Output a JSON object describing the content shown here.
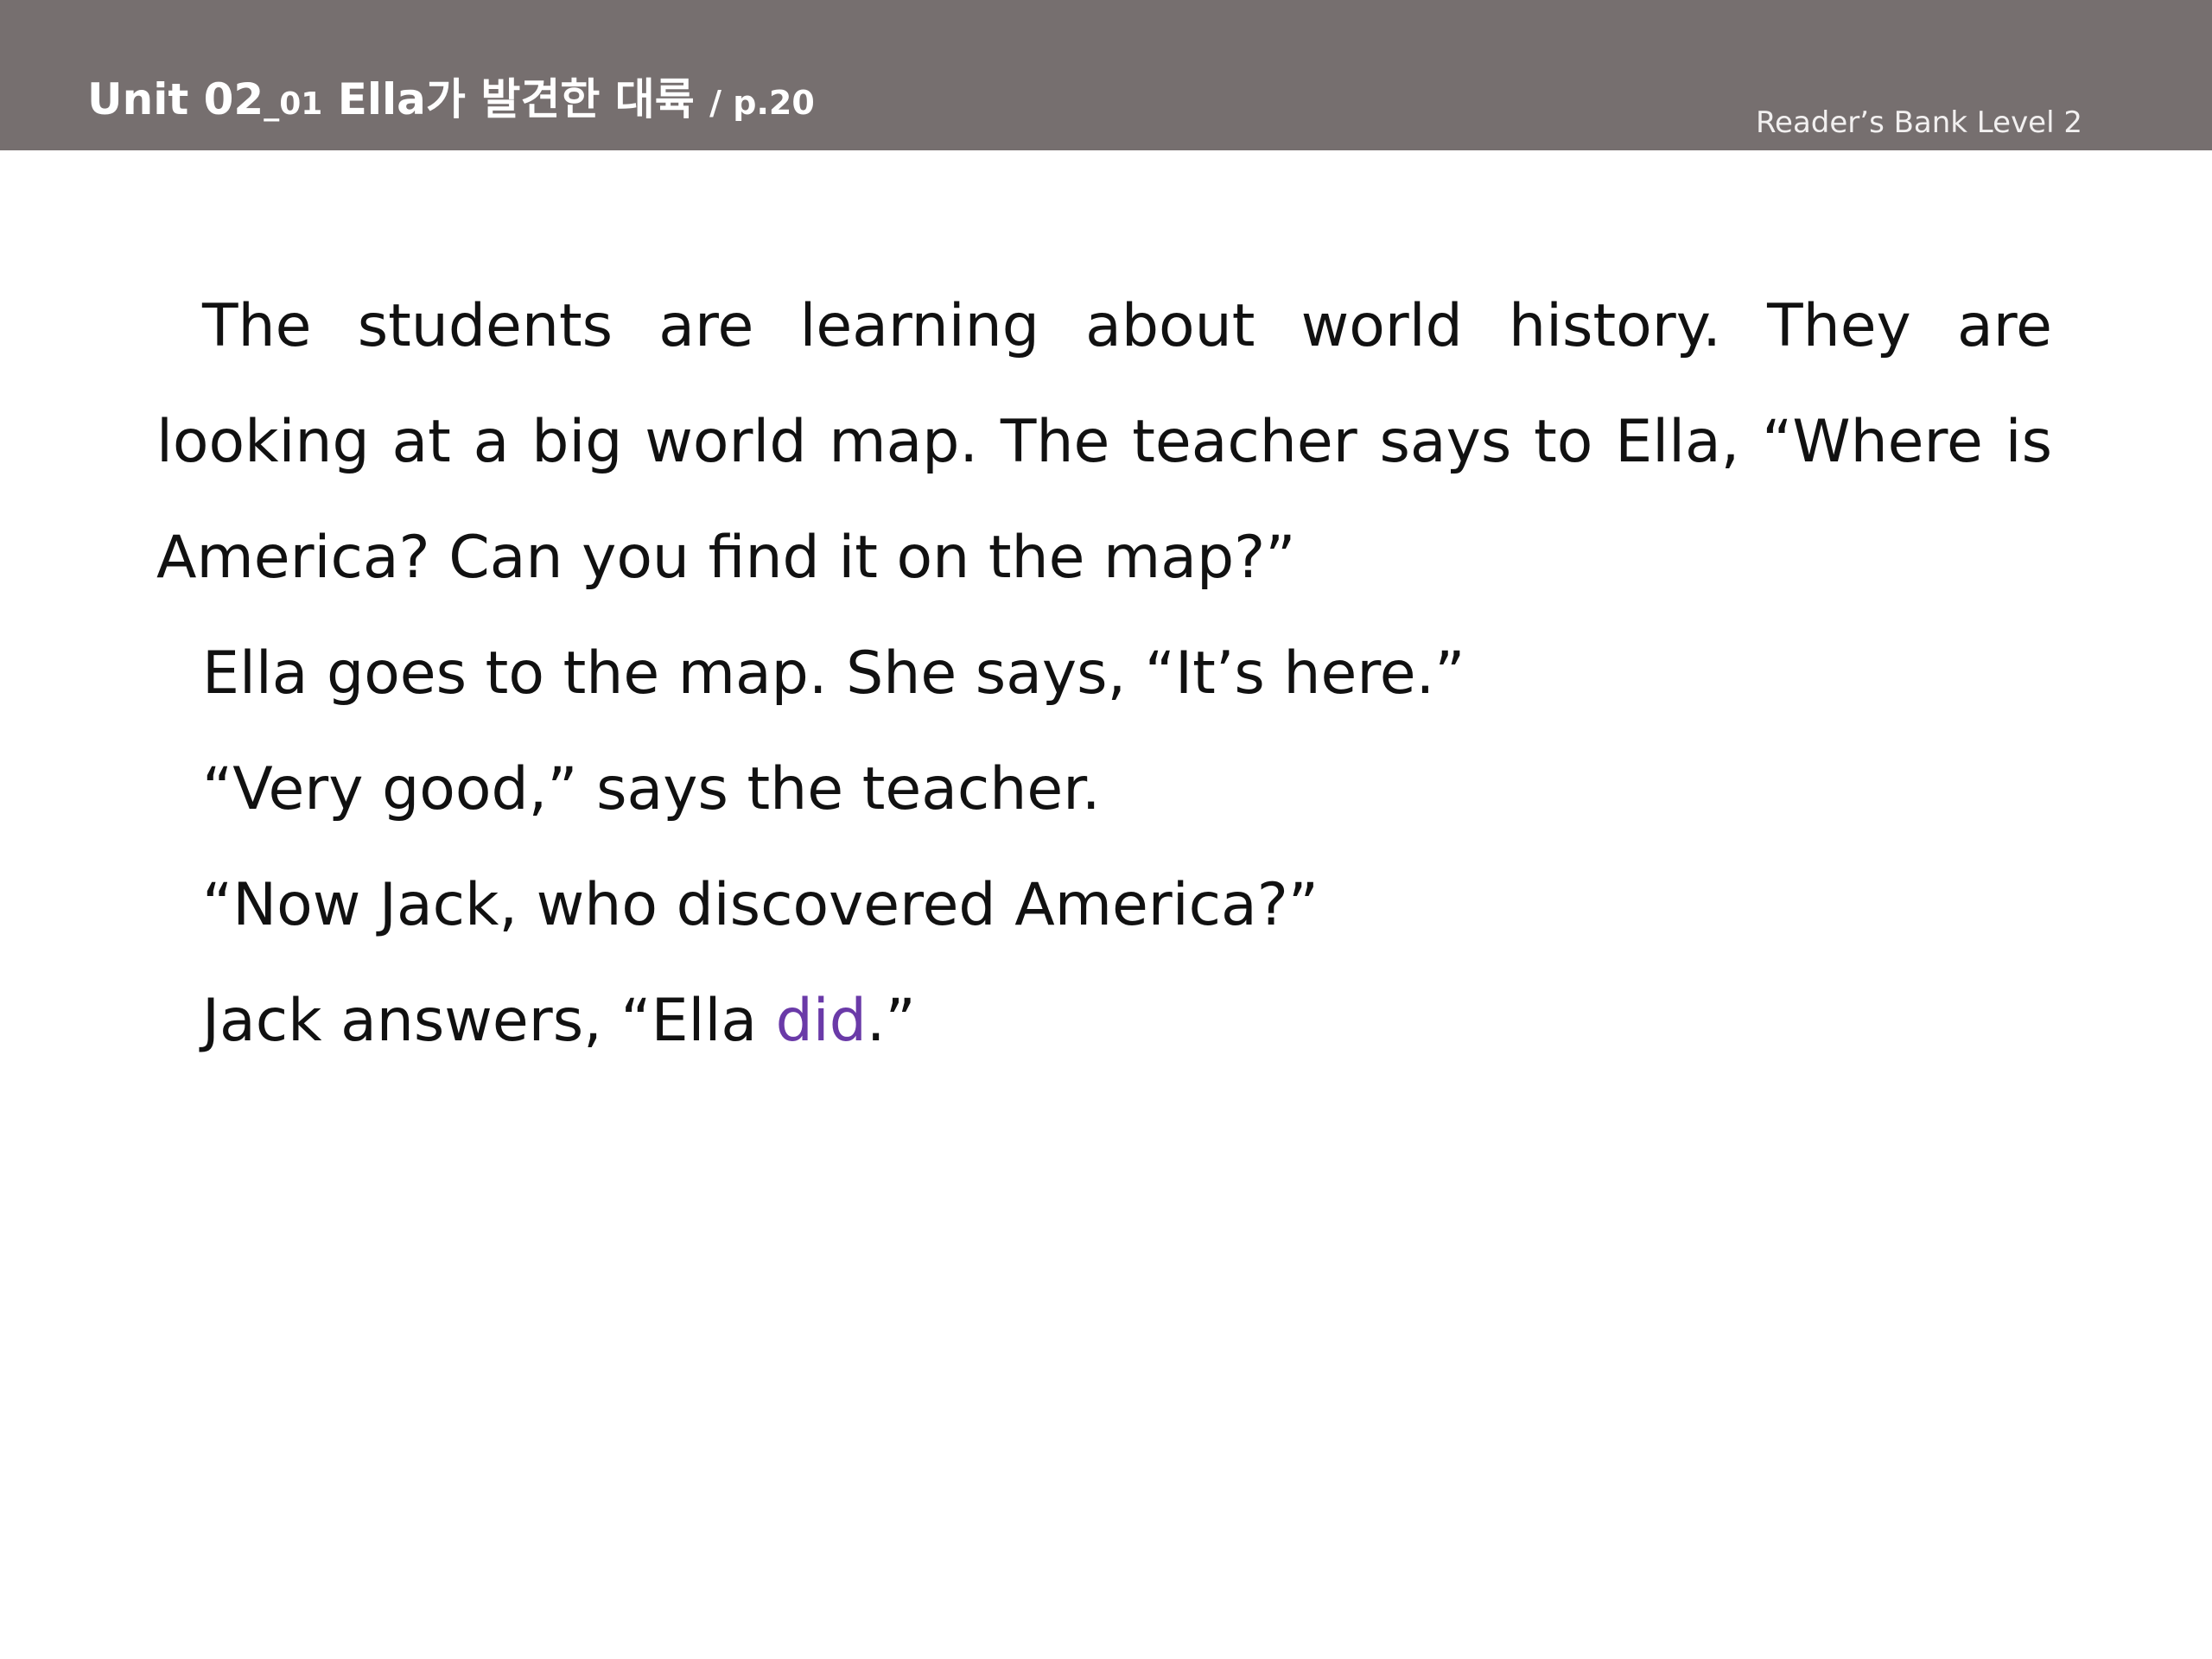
{
  "header": {
    "unit": "Unit 02",
    "sub": "_01",
    "title": " Ella가 발견한 대륙 ",
    "page_ref": "/ p.20",
    "series": "Reader’s Bank Level 2"
  },
  "passage": {
    "p1": "The students are learning about world history. They are looking at a big world map. The teacher says to Ella, “Where is America? Can you find it on the map?”",
    "p2": "Ella goes to the map. She says, “It’s here.”",
    "p3": "“Very good,” says the teacher.",
    "p4": "“Now Jack, who discovered America?”",
    "p5_before": "Jack answers, “Ella ",
    "p5_highlight": "did",
    "p5_after": ".”"
  },
  "colors": {
    "header_bg": "#766f6f",
    "highlight": "#6a3aa8"
  }
}
